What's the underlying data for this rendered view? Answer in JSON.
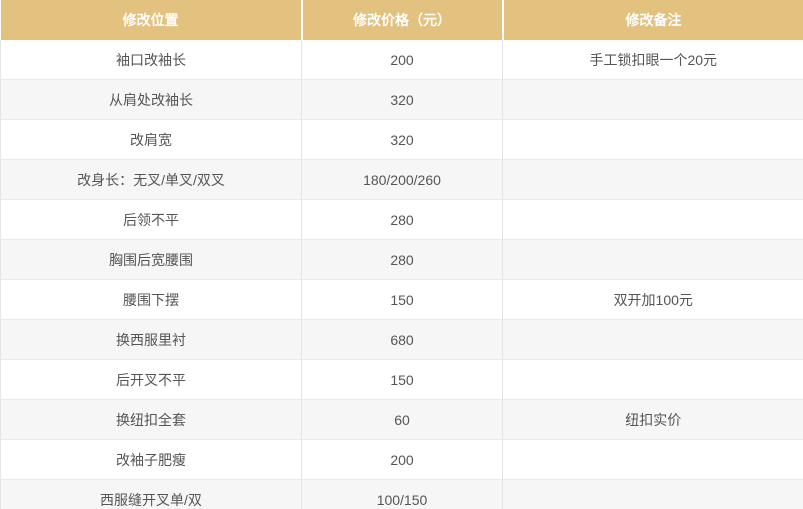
{
  "header": {
    "col_position": "修改位置",
    "col_price": "修改价格（元）",
    "col_note": "修改备注"
  },
  "rows": [
    {
      "position": "袖口改袖长",
      "price": "200",
      "note": "手工锁扣眼一个20元"
    },
    {
      "position": "从肩处改袖长",
      "price": "320",
      "note": ""
    },
    {
      "position": "改肩宽",
      "price": "320",
      "note": ""
    },
    {
      "position": "改身长：无叉/单叉/双叉",
      "price": "180/200/260",
      "note": ""
    },
    {
      "position": "后领不平",
      "price": "280",
      "note": ""
    },
    {
      "position": "胸围后宽腰围",
      "price": "280",
      "note": ""
    },
    {
      "position": "腰围下摆",
      "price": "150",
      "note": "双开加100元"
    },
    {
      "position": "换西服里衬",
      "price": "680",
      "note": ""
    },
    {
      "position": "后开叉不平",
      "price": "150",
      "note": ""
    },
    {
      "position": "换纽扣全套",
      "price": "60",
      "note": "纽扣实价"
    },
    {
      "position": "改袖子肥瘦",
      "price": "200",
      "note": ""
    },
    {
      "position": "西服缝开叉单/双",
      "price": "100/150",
      "note": ""
    }
  ],
  "colors": {
    "header_bg": "#e3c17f",
    "header_text": "#ffffff",
    "stripe_bg": "#f6f6f6",
    "body_text": "#555555"
  }
}
